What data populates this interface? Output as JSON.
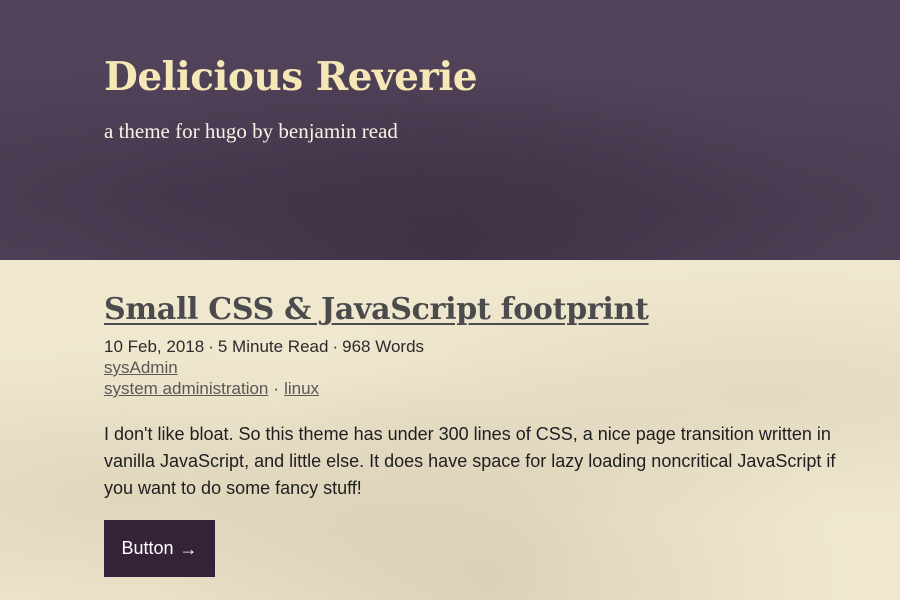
{
  "header": {
    "title": "Delicious Reverie",
    "tagline": "a theme for hugo by benjamin read"
  },
  "post": {
    "title": "Small CSS & JavaScript footprint",
    "date": "10 Feb, 2018",
    "read_time": "5 Minute Read",
    "word_count": "968 Words",
    "meta_separator": "·",
    "author": "sysAdmin",
    "tags": [
      "system administration",
      "linux"
    ],
    "excerpt": "I don't like bloat. So this theme has under 300 lines of CSS, a nice page transition written in vanilla JavaScript, and little else. It does have space for lazy loading noncritical JavaScript if you want to do some fancy stuff!",
    "button_label": "Button",
    "button_icon": "arrow-right-icon",
    "button_arrow": "→"
  },
  "colors": {
    "header_bg": "#52445a",
    "title_color": "#f6e7b6",
    "content_bg": "#efe8cf",
    "button_bg": "#332238"
  }
}
